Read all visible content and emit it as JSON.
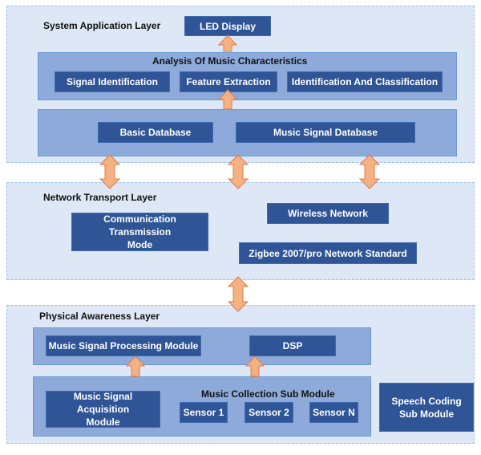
{
  "layers": {
    "application": {
      "title": "System Application Layer",
      "led": "LED Display",
      "analysis": {
        "title": "Analysis Of Music Characteristics",
        "items": [
          "Signal Identification",
          "Feature Extraction",
          "Identification And Classification"
        ]
      },
      "databases": [
        "Basic Database",
        "Music Signal Database"
      ]
    },
    "network": {
      "title": "Network Transport Layer",
      "communication": "Communication Transmission Mode",
      "wireless": "Wireless Network",
      "zigbee": "Zigbee 2007/pro Network Standard"
    },
    "physical": {
      "title": "Physical Awareness Layer",
      "processing": "Music Signal Processing Module",
      "dsp": "DSP",
      "acquisition": "Music Signal Acquisition Module",
      "collection_title": "Music Collection Sub Module",
      "sensors": [
        "Sensor 1",
        "Sensor 2",
        "Sensor N"
      ],
      "speech": "Speech Coding Sub Module"
    }
  },
  "colors": {
    "box": "#2f5597",
    "panel": "#8eaadb",
    "layer": "#dee7f5",
    "arrow": "#f4b183",
    "arrow_stroke": "#e07b4a"
  }
}
